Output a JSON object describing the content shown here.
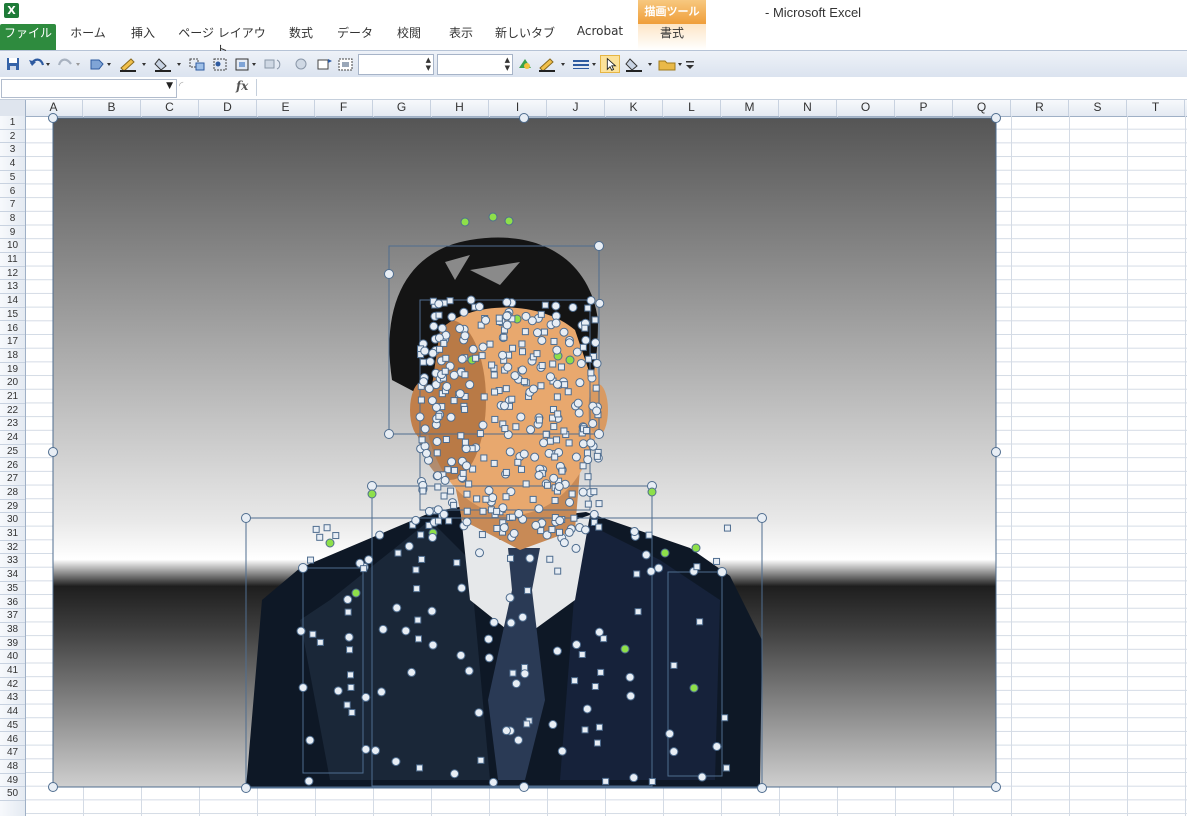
{
  "app": {
    "icon": "excel-icon",
    "icon_glyph": "X",
    "title": "- Microsoft Excel"
  },
  "ribbon": {
    "tabs": [
      "ファイル",
      "ホーム",
      "挿入",
      "ページ レイアウト",
      "数式",
      "データ",
      "校閲",
      "表示",
      "新しいタブ",
      "Acrobat"
    ],
    "context_header": "描画ツール",
    "context_tab": "書式"
  },
  "quick_access": {
    "icons": [
      "save-icon",
      "undo-icon",
      "redo-icon",
      "shape-icon",
      "pen-icon",
      "fill-icon",
      "select-group-icon",
      "select-objects-icon",
      "align-icon",
      "rotate-icon",
      "bring-forward-icon",
      "send-backward-icon",
      "text-box-icon",
      "line-color-icon",
      "line-style-icon",
      "pointer-icon",
      "fill-color-icon",
      "open-folder-icon",
      "customize-icon"
    ],
    "spin1_value": "",
    "spin2_value": ""
  },
  "formula_bar": {
    "name_box": "",
    "fx_label": "fx",
    "formula": ""
  },
  "sheet": {
    "columns": [
      "A",
      "B",
      "C",
      "D",
      "E",
      "F",
      "G",
      "H",
      "I",
      "J",
      "K",
      "L",
      "M",
      "N",
      "O",
      "P",
      "Q",
      "R",
      "S",
      "T"
    ],
    "rows": [
      "1",
      "2",
      "3",
      "4",
      "5",
      "6",
      "7",
      "8",
      "9",
      "10",
      "11",
      "12",
      "13",
      "14",
      "15",
      "16",
      "17",
      "18",
      "19",
      "20",
      "21",
      "22",
      "23",
      "24",
      "25",
      "26",
      "27",
      "28",
      "29",
      "30",
      "31",
      "32",
      "33",
      "34",
      "35",
      "36",
      "37",
      "38",
      "39",
      "40",
      "41",
      "42",
      "43",
      "44",
      "45",
      "46",
      "47",
      "48",
      "49",
      "50"
    ]
  },
  "image": {
    "description_name": "businessman-illustration",
    "colors": {
      "suit": "#0e1826",
      "skin": "#e8a86e",
      "hair": "#141414",
      "shirt": "#e6e8ea",
      "tie": "#2a3a55",
      "handle_fill": "#e8eef5",
      "handle_stroke": "#4f6d8f",
      "rotate_handle": "#8ee04a"
    }
  }
}
